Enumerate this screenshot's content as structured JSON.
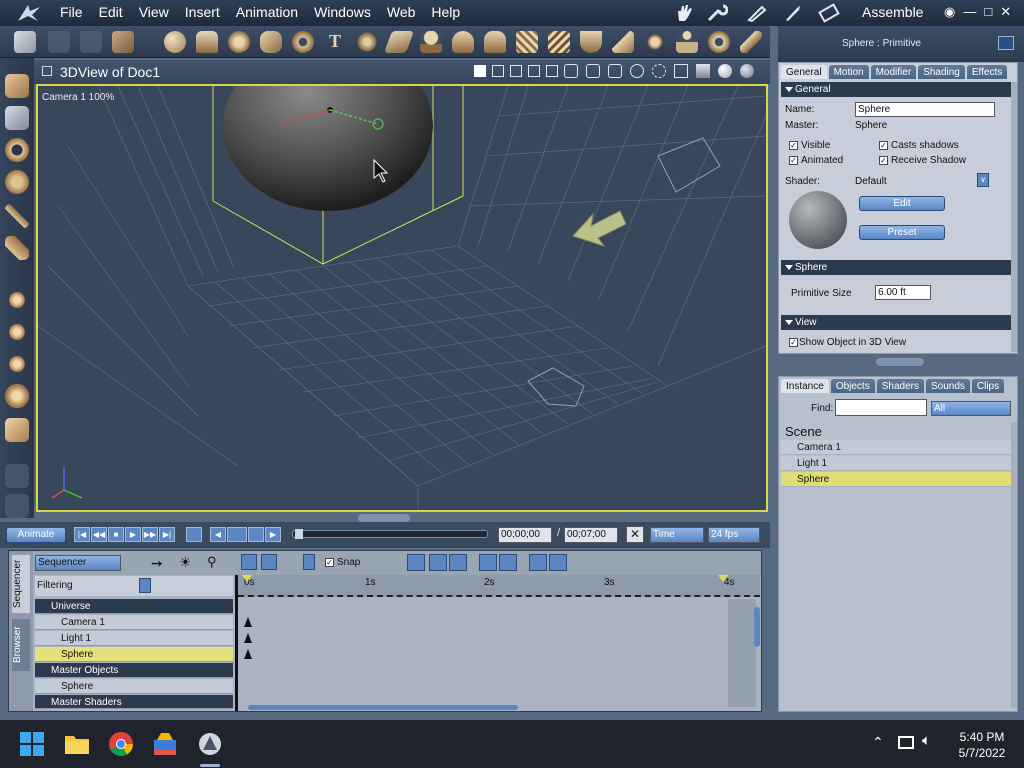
{
  "menubar": {
    "items": [
      "File",
      "Edit",
      "View",
      "Insert",
      "Animation",
      "Windows",
      "Web",
      "Help"
    ],
    "room": "Assemble"
  },
  "viewport": {
    "title": "3DView of Doc1",
    "camera_label": "Camera 1 100%"
  },
  "properties": {
    "title": "Sphere : Primitive",
    "tabs": [
      "General",
      "Motion",
      "Modifier",
      "Shading",
      "Effects"
    ],
    "general_section": "General",
    "name_label": "Name:",
    "name_value": "Sphere",
    "master_label": "Master:",
    "master_value": "Sphere",
    "visible": "Visible",
    "casts_shadows": "Casts shadows",
    "animated": "Animated",
    "receive_shadow": "Receive Shadow",
    "shader_label": "Shader:",
    "shader_value": "Default",
    "edit_button": "Edit",
    "preset_button": "Preset",
    "sphere_section": "Sphere",
    "primitive_size_label": "Primitive Size",
    "primitive_size_value": "6.00 ft",
    "view_section": "View",
    "show_object": "Show Object in 3D View"
  },
  "scene_panel": {
    "tabs": [
      "Instance",
      "Objects",
      "Shaders",
      "Sounds",
      "Clips"
    ],
    "find_label": "Find:",
    "find_value": "",
    "filter_value": "All",
    "heading": "Scene",
    "items": [
      "Camera 1",
      "Light 1",
      "Sphere"
    ],
    "selected": "Sphere"
  },
  "timeline": {
    "animate_button": "Animate",
    "current_time": "00;00;00",
    "end_time": "00;07;00",
    "time_mode": "Time",
    "fps": "24 fps"
  },
  "sequencer": {
    "mode": "Sequencer",
    "snap_label": "Snap",
    "filtering_label": "Filtering",
    "side_tabs": [
      "Sequencer",
      "Browser"
    ],
    "rows": [
      {
        "label": "Universe",
        "type": "group"
      },
      {
        "label": "Camera 1",
        "type": "item"
      },
      {
        "label": "Light 1",
        "type": "item"
      },
      {
        "label": "Sphere",
        "type": "selected"
      },
      {
        "label": "Master Objects",
        "type": "group"
      },
      {
        "label": "Sphere",
        "type": "item"
      },
      {
        "label": "Master Shaders",
        "type": "group"
      }
    ],
    "ruler_ticks": [
      "0s",
      "1s",
      "2s",
      "3s",
      "4s"
    ]
  },
  "taskbar": {
    "time": "5:40 PM",
    "date": "5/7/2022"
  }
}
